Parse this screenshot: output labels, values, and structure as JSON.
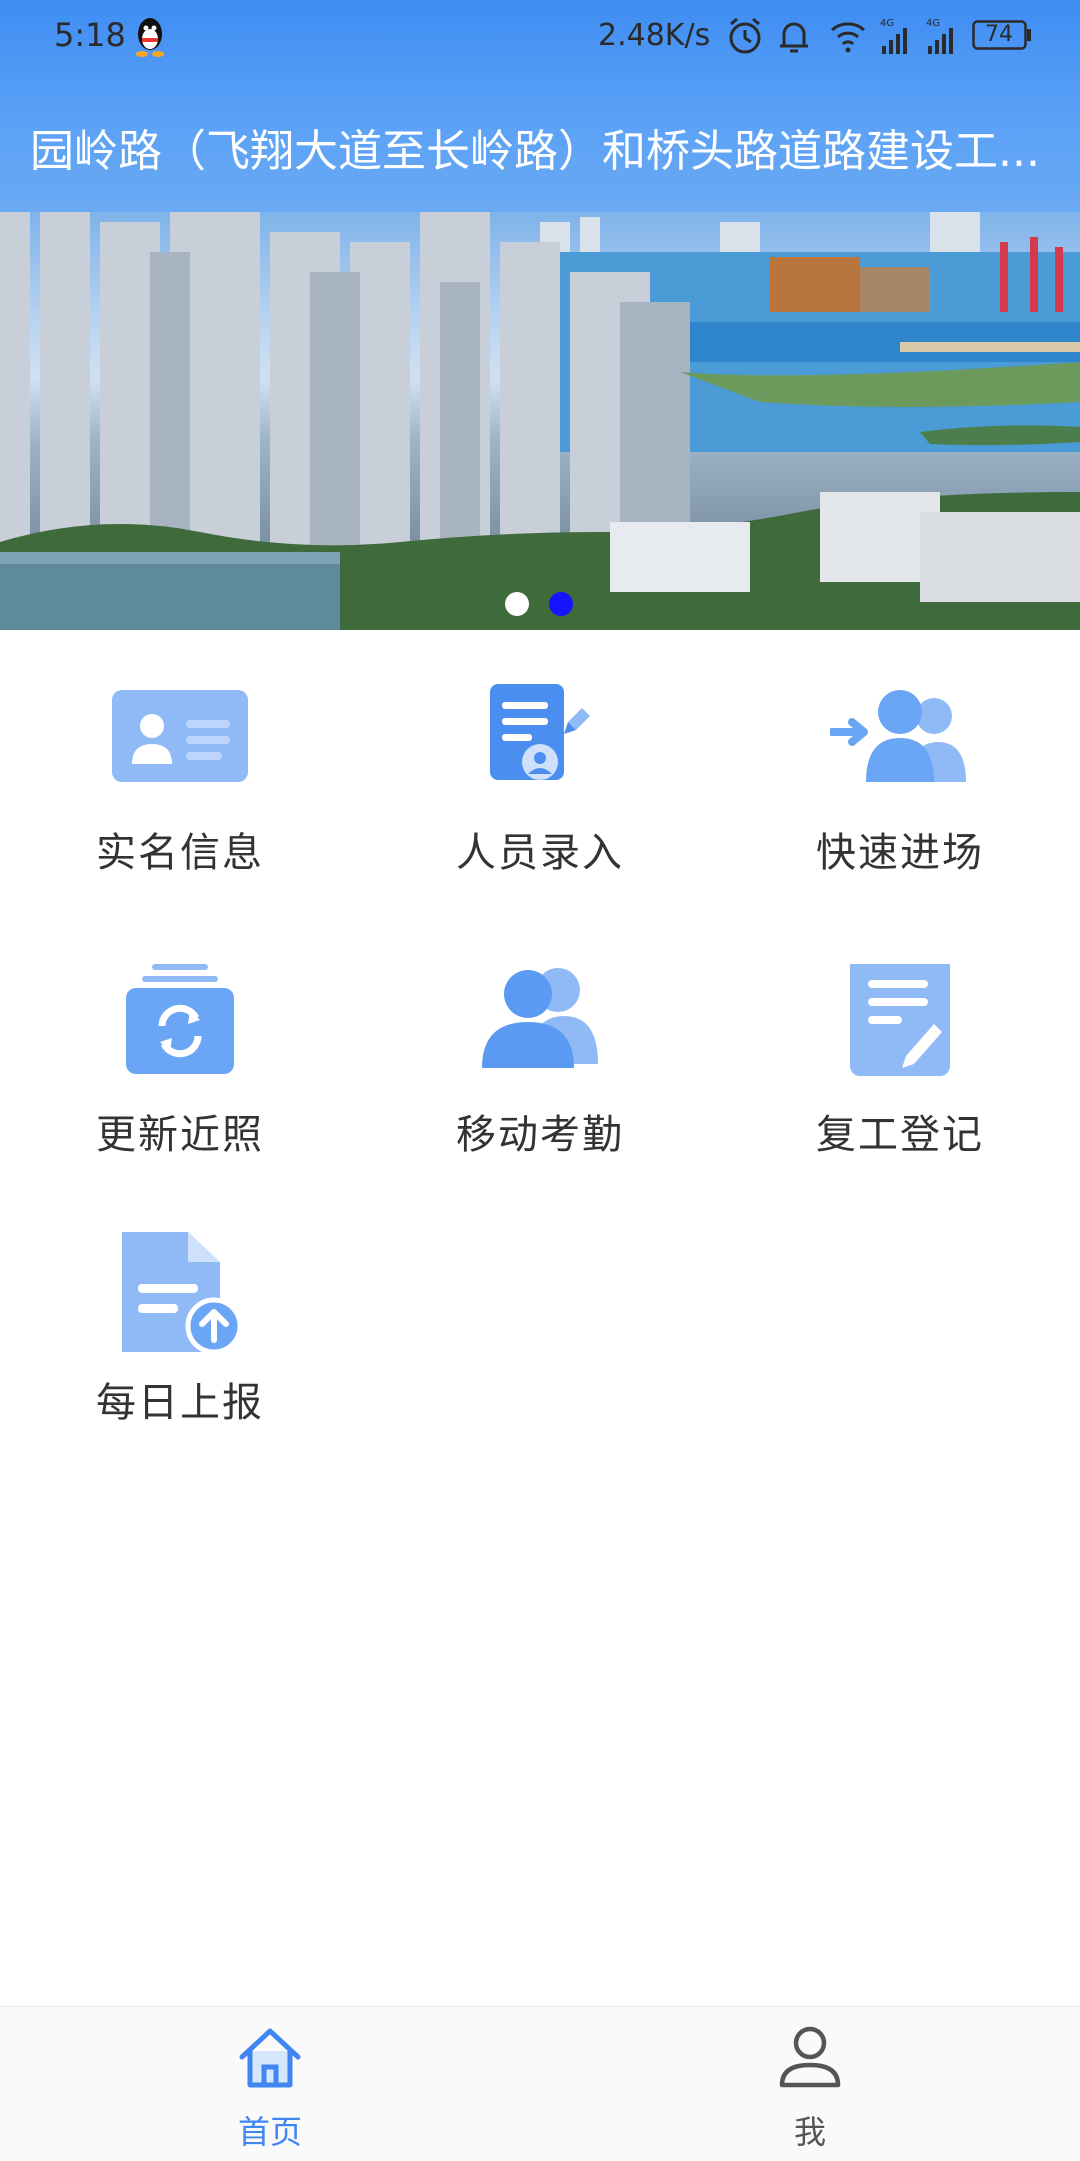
{
  "status_bar": {
    "time": "5:18",
    "net_speed": "2.48K/s",
    "battery": "74",
    "icons": [
      "qq-icon",
      "alarm-icon",
      "bell-icon",
      "wifi-icon",
      "signal-4g-icon",
      "signal-4g-icon",
      "battery-icon"
    ]
  },
  "header": {
    "title": "园岭路（飞翔大道至长岭路）和桥头路道路建设工..."
  },
  "banner": {
    "description_icon": "city-skyline-photo",
    "active_dot": 2,
    "dot_count": 2
  },
  "grid": {
    "items": [
      {
        "label": "实名信息",
        "icon": "id-card-icon"
      },
      {
        "label": "人员录入",
        "icon": "document-edit-icon"
      },
      {
        "label": "快速进场",
        "icon": "people-enter-icon"
      },
      {
        "label": "更新近照",
        "icon": "refresh-photo-icon"
      },
      {
        "label": "移动考勤",
        "icon": "people-icon"
      },
      {
        "label": "复工登记",
        "icon": "register-icon"
      },
      {
        "label": "每日上报",
        "icon": "upload-report-icon"
      }
    ]
  },
  "bottom_nav": {
    "tabs": [
      {
        "label": "首页",
        "icon": "home-icon"
      },
      {
        "label": "我",
        "icon": "user-icon"
      }
    ],
    "active_color": "#3f86f0",
    "inactive_color": "#555555"
  },
  "colors": {
    "accent": "#3f8df3",
    "icon_blue": "#6aa5f6"
  }
}
